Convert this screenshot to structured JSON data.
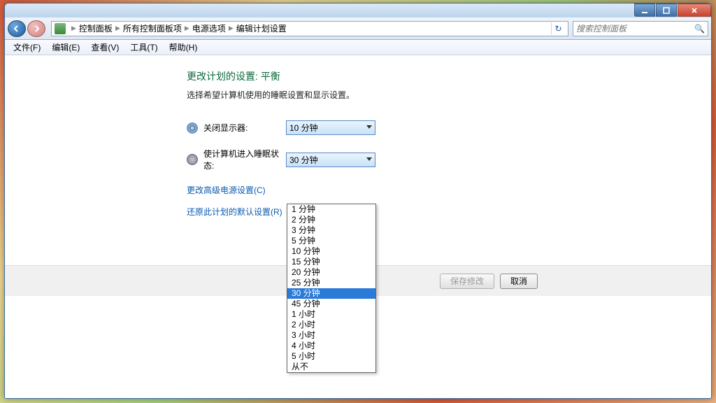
{
  "window_controls": {
    "min": "min",
    "max": "max",
    "close": "close"
  },
  "breadcrumbs": {
    "root": "控制面板",
    "level1": "所有控制面板项",
    "level2": "电源选项",
    "level3": "编辑计划设置"
  },
  "search_placeholder": "搜索控制面板",
  "menu": {
    "file": "文件(F)",
    "edit": "编辑(E)",
    "view": "查看(V)",
    "tools": "工具(T)",
    "help": "帮助(H)"
  },
  "page": {
    "title": "更改计划的设置: 平衡",
    "subtitle": "选择希望计算机使用的睡眠设置和显示设置。",
    "display_off_label": "关闭显示器:",
    "display_off_value": "10 分钟",
    "sleep_label": "使计算机进入睡眠状态:",
    "sleep_value": "30 分钟",
    "link_advanced": "更改高级电源设置(C)",
    "link_restore": "还原此计划的默认设置(R)"
  },
  "buttons": {
    "save": "保存修改",
    "cancel": "取消"
  },
  "dropdown": {
    "selected_index": 8,
    "options": [
      "1 分钟",
      "2 分钟",
      "3 分钟",
      "5 分钟",
      "10 分钟",
      "15 分钟",
      "20 分钟",
      "25 分钟",
      "30 分钟",
      "45 分钟",
      "1 小时",
      "2 小时",
      "3 小时",
      "4 小时",
      "5 小时",
      "从不"
    ]
  }
}
